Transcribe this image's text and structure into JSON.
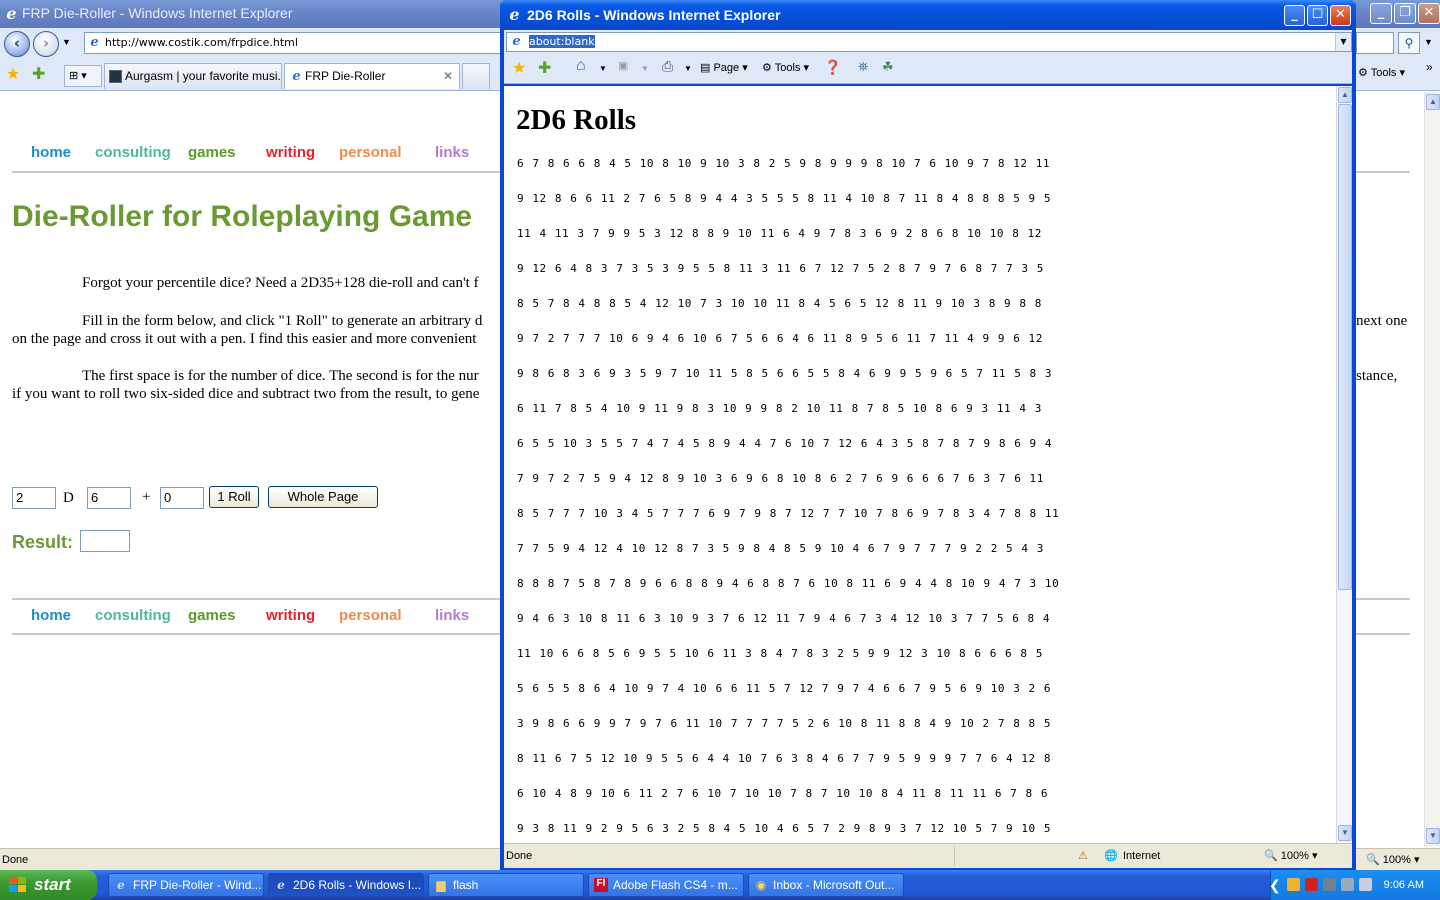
{
  "bg_window": {
    "title": "FRP Die-Roller - Windows Internet Explorer",
    "url": "http://www.costik.com/frpdice.html",
    "tabs": [
      {
        "label": "Aurgasm | your favorite musi..."
      },
      {
        "label": "FRP Die-Roller"
      }
    ],
    "tools_label": "Tools",
    "status": "Done",
    "zoom": "100%"
  },
  "site": {
    "nav": [
      "home",
      "consulting",
      "games",
      "writing",
      "personal",
      "links"
    ],
    "nav_colors": [
      "#1a8fc8",
      "#4fb89a",
      "#5a9a2a",
      "#e2262e",
      "#f08c4a",
      "#b47ad0"
    ],
    "heading": "Die-Roller for Roleplaying Game",
    "para1": "Forgot your percentile dice? Need a 2D35+128 die-roll and can't f",
    "para2_line1": "Fill in the form below, and click \"1 Roll\" to generate an arbitrary d",
    "para2_line1_right": "next one",
    "para2_line2": "on the page and cross it out with a pen. I find this easier and more convenient",
    "para3_line1": "The first space is for the number of dice. The second is for the nur",
    "para3_line1_right": "stance,",
    "para3_line2": "if you want to roll two six-sided dice and subtract two from the result, to gene",
    "form": {
      "dice": "2",
      "d_label": "D",
      "sides": "6",
      "plus_label": "+",
      "modifier": "0",
      "roll_button": "1 Roll",
      "page_button": "Whole Page",
      "result_label": "Result:",
      "result_value": ""
    }
  },
  "popup": {
    "title": "2D6 Rolls - Windows Internet Explorer",
    "url": "about:blank",
    "cmd": {
      "page": "Page",
      "tools": "Tools"
    },
    "heading": "2D6 Rolls",
    "rolls": [
      "6 7 8 6 6 8 4 5 10 8 10 9 10 3 8 2 5 9 8 9 9 9 8 10 7 6 10 9 7 8 12 11",
      "9 12 8 6 6 11 2 7 6 5 8 9 4 4 3 5 5 5 8 11 4 10 8 7 11 8 4 8 8 8 5 9 5",
      "11 4 11 3 7 9 9 5 3 12 8 8 9 10 11 6 4 9 7 8 3 6 9 2 8 6 8 10 10 8 12",
      "9 12 6 4 8 3 7 3 5 3 9 5 5 8 11 3 11 6 7 12 7 5 2 8 7 9 7 6 8 7 7 3 5",
      "8 5 7 8 4 8 8 5 4 12 10 7 3 10 10 11 8 4 5 6 5 12 8 11 9 10 3 8 9 8 8",
      "9 7 2 7 7 7 10 6 9 4 6 10 6 7 5 6 6 4 6 11 8 9 5 6 11 7 11 4 9 9 6 12",
      "9 8 6 8 3 6 9 3 5 9 7 10 11 5 8 5 6 6 5 5 8 4 6 9 9 5 9 6 5 7 11 5 8 3",
      "6 11 7 8 5 4 10 9 11 9 8 3 10 9 9 8 2 10 11 8 7 8 5 10 8 6 9 3 11 4 3",
      "6 5 5 10 3 5 5 7 4 7 4 5 8 9 4 4 7 6 10 7 12 6 4 3 5 8 7 8 7 9 8 6 9 4",
      "7 9 7 2 7 5 9 4 12 8 9 10 3 6 9 6 8 10 8 6 2 7 6 9 6 6 6 7 6 3 7 6 11",
      "8 5 7 7 7 10 3 4 5 7 7 7 6 9 7 9 8 7 12 7 7 10 7 8 6 9 7 8 3 4 7 8 8 11",
      "7 7 5 9 4 12 4 10 12 8 7 3 5 9 8 4 8 5 9 10 4 6 7 9 7 7 7 9 2 2 5 4 3",
      "8 8 8 7 5 8 7 8 9 6 6 8 8 9 4 6 8 8 7 6 10 8 11 6 9 4 4 8 10 9 4 7 3 10",
      "9 4 6 3 10 8 11 6 3 10 9 3 7 6 12 11 7 9 4 6 7 3 4 12 10 3 7 7 5 6 8 4",
      "11 10 6 6 8 5 6 9 5 5 10 6 11 3 8 4 7 8 3 2 5 9 9 12 3 10 8 6 6 6 8 5",
      "5 6 5 5 8 6 4 10 9 7 4 10 6 6 11 5 7 12 7 9 7 4 6 6 7 9 5 6 9 10 3 2 6",
      "3 9 8 6 6 9 9 7 9 7 6 11 10 7 7 7 7 5 2 6 10 8 11 8 8 4 9 10 2 7 8 8 5",
      "8 11 6 7 5 12 10 9 5 5 6 4 4 10 7 6 3 8 4 6 7 7 9 5 9 9 9 7 7 6 4 12 8",
      "6 10 4 8 9 10 6 11 2 7 6 10 7 10 10 7 8 7 10 10 8 4 11 8 11 11 6 7 8 6",
      "9 3 8 11 9 2 9 5 6 3 2 5 8 4 5 10 4 6 5 7 2 9 8 9 3 7 12 10 5 7 9 10 5"
    ],
    "status": "Done",
    "zone": "Internet",
    "zoom": "100%"
  },
  "taskbar": {
    "start": "start",
    "tasks": [
      {
        "label": "FRP Die-Roller - Wind..."
      },
      {
        "label": "2D6 Rolls - Windows I..."
      },
      {
        "label": "flash"
      },
      {
        "label": "Adobe Flash CS4 - m..."
      },
      {
        "label": "Inbox - Microsoft Out..."
      }
    ],
    "clock": "9:06 AM"
  }
}
